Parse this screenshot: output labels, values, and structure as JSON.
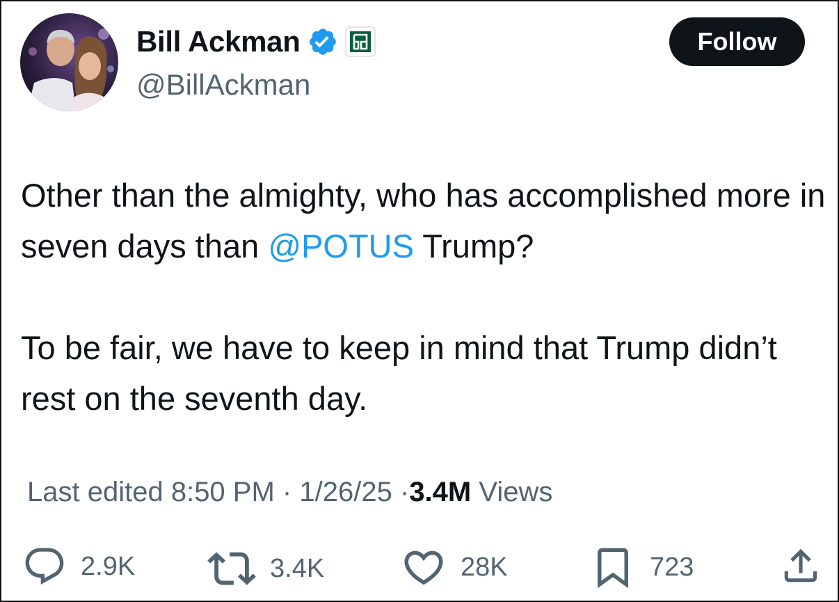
{
  "author": {
    "name": "Bill Ackman",
    "handle": "@BillAckman",
    "verified_icon": "verified-badge-icon",
    "affiliate_icon": "affiliate-logo-icon"
  },
  "follow_button": {
    "label": "Follow"
  },
  "tweet": {
    "paragraph1": {
      "before": "Other than the almighty, who has accomplished more in seven days than ",
      "mention": "@POTUS",
      "after": " Trump?"
    },
    "paragraph2": "To be fair, we have to keep in mind that Trump didn’t rest on the seventh day."
  },
  "meta": {
    "edited_label": "Last edited",
    "time": "8:50 PM",
    "separator": "·",
    "date": "1/26/25",
    "views_count": "3.4M",
    "views_label": "Views"
  },
  "actions": {
    "replies": "2.9K",
    "reposts": "3.4K",
    "likes": "28K",
    "bookmarks": "723"
  },
  "colors": {
    "text": "#0f1419",
    "secondary": "#536471",
    "mention": "#1d9bf0",
    "verified": "#1d9bf0",
    "button_bg": "#0f1419"
  }
}
